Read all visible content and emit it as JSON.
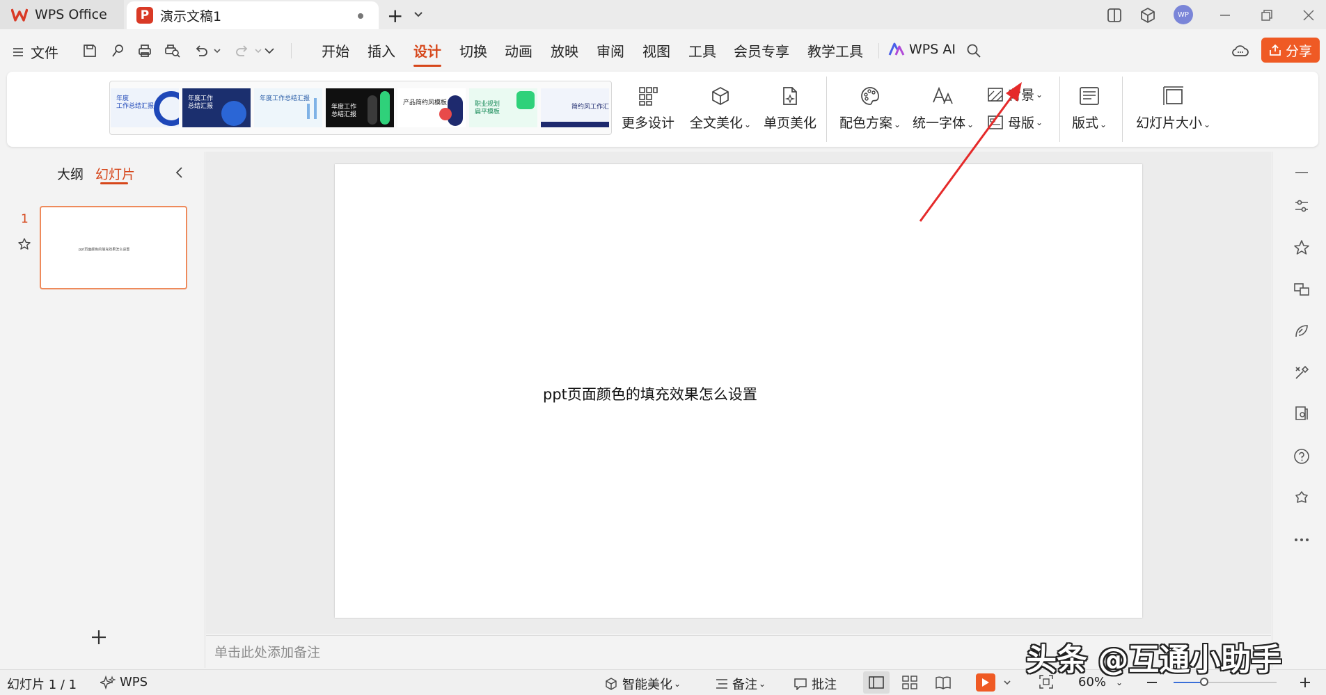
{
  "titlebar": {
    "app_tab": "WPS Office",
    "doc_badge": "P",
    "doc_tab": "演示文稿1",
    "new_tab": "+",
    "avatar": "WP"
  },
  "menu": {
    "file": "文件",
    "items": [
      "开始",
      "插入",
      "设计",
      "切换",
      "动画",
      "放映",
      "审阅",
      "视图",
      "工具",
      "会员专享",
      "教学工具"
    ],
    "active": "设计",
    "wps_ai": "WPS AI",
    "share": "分享"
  },
  "ribbon": {
    "designs": [
      {
        "text": "年度\n工作总结汇报",
        "bg": "#eef3fb",
        "fg": "#1e47b8"
      },
      {
        "text": "年度工作\n总结汇报",
        "bg": "#1b2f6e",
        "fg": "#ffffff"
      },
      {
        "text": "年度工作总结汇报",
        "bg": "#eef6fb",
        "fg": "#2b5ea8"
      },
      {
        "text": "年度工作\n总结汇报",
        "bg": "#101010",
        "fg": "#ffffff"
      },
      {
        "text": "产品简约风模板",
        "bg": "#ffffff",
        "fg": "#222222"
      },
      {
        "text": "职业规划\n扁平模板",
        "bg": "#eafaf2",
        "fg": "#1a8c5a"
      },
      {
        "text": "简约风工作汇报",
        "bg": "#f1f4fb",
        "fg": "#1e2a6e"
      }
    ],
    "more_design": "更多设计",
    "full_beautify": "全文美化",
    "page_beautify": "单页美化",
    "color_scheme": "配色方案",
    "unify_font": "统一字体",
    "background": "背景",
    "master": "母版",
    "layout": "版式",
    "slide_size": "幻灯片大小"
  },
  "left_panel": {
    "outline_tab": "大纲",
    "slides_tab": "幻灯片",
    "slide_number": "1"
  },
  "slide": {
    "text": "ppt页面颜色的填充效果怎么设置"
  },
  "notes": {
    "placeholder": "单击此处添加备注"
  },
  "status": {
    "slide_info": "幻灯片 1 / 1",
    "wps": "WPS",
    "smart_beautify": "智能美化",
    "notes": "备注",
    "comments": "批注",
    "zoom": "60%",
    "zoom_fraction": 0.3
  },
  "watermark": "头条 @互通小助手",
  "colors": {
    "accent": "#d6461a",
    "share": "#ef5a24",
    "arrow": "#e52a2a"
  }
}
